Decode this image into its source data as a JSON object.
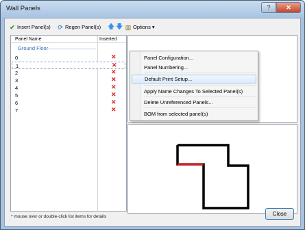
{
  "window": {
    "title": "Wall Panels",
    "help_glyph": "?",
    "close_glyph": "✕"
  },
  "toolbar": {
    "insert_label": "Insert Panel(s)",
    "regen_label": "Regen Panel(s)",
    "options_label": "Options",
    "options_arrow": "▾"
  },
  "list": {
    "col_name": "Panel Name",
    "col_inserted": "Inserted",
    "group": "Ground Floor",
    "rows": [
      {
        "name": "0",
        "inserted": "✕"
      },
      {
        "name": "1",
        "inserted": "✕"
      },
      {
        "name": "2",
        "inserted": "✕"
      },
      {
        "name": "3",
        "inserted": "✕"
      },
      {
        "name": "4",
        "inserted": "✕"
      },
      {
        "name": "5",
        "inserted": "✕"
      },
      {
        "name": "6",
        "inserted": "✕"
      },
      {
        "name": "7",
        "inserted": "✕"
      }
    ],
    "selected_row": "1"
  },
  "hint": "* mouse over or double-click list items for details",
  "menu": {
    "items": [
      "Panel Configuration...",
      "Panel Numbering...",
      "Default Print Setup...",
      "Apply Name Changes To Selected Panel(s)",
      "Delete Unreferenced Panels...",
      "BOM  from selected panel(s)"
    ],
    "highlighted": "Default Print Setup..."
  },
  "close_label": "Close",
  "colors": {
    "accent": "#3a8ee6",
    "x_mark": "#d62020",
    "highlight_wall": "#e02020"
  }
}
